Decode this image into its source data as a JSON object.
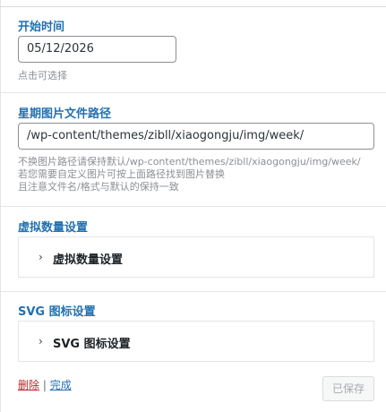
{
  "start_time": {
    "label": "开始时间",
    "value": "05/12/2026",
    "help": "点击可选择"
  },
  "week_image_path": {
    "label": "星期图片文件路径",
    "value": "/wp-content/themes/zibll/xiaogongju/img/week/",
    "help_lines": [
      "不换图片路径请保持默认/wp-content/themes/zibll/xiaogongju/img/week/",
      "若您需要自定义图片可按上面路径找到图片替换",
      "且注意文件名/格式与默认的保持一致"
    ]
  },
  "virtual_count": {
    "label": "虚拟数量设置",
    "accordion_title": "虚拟数量设置"
  },
  "svg_icon": {
    "label": "SVG 图标设置",
    "accordion_title": "SVG 图标设置"
  },
  "footer": {
    "delete_label": "删除",
    "separator": "|",
    "done_label": "完成",
    "saved_label": "已保存"
  },
  "icons": {
    "chevron": "›"
  }
}
